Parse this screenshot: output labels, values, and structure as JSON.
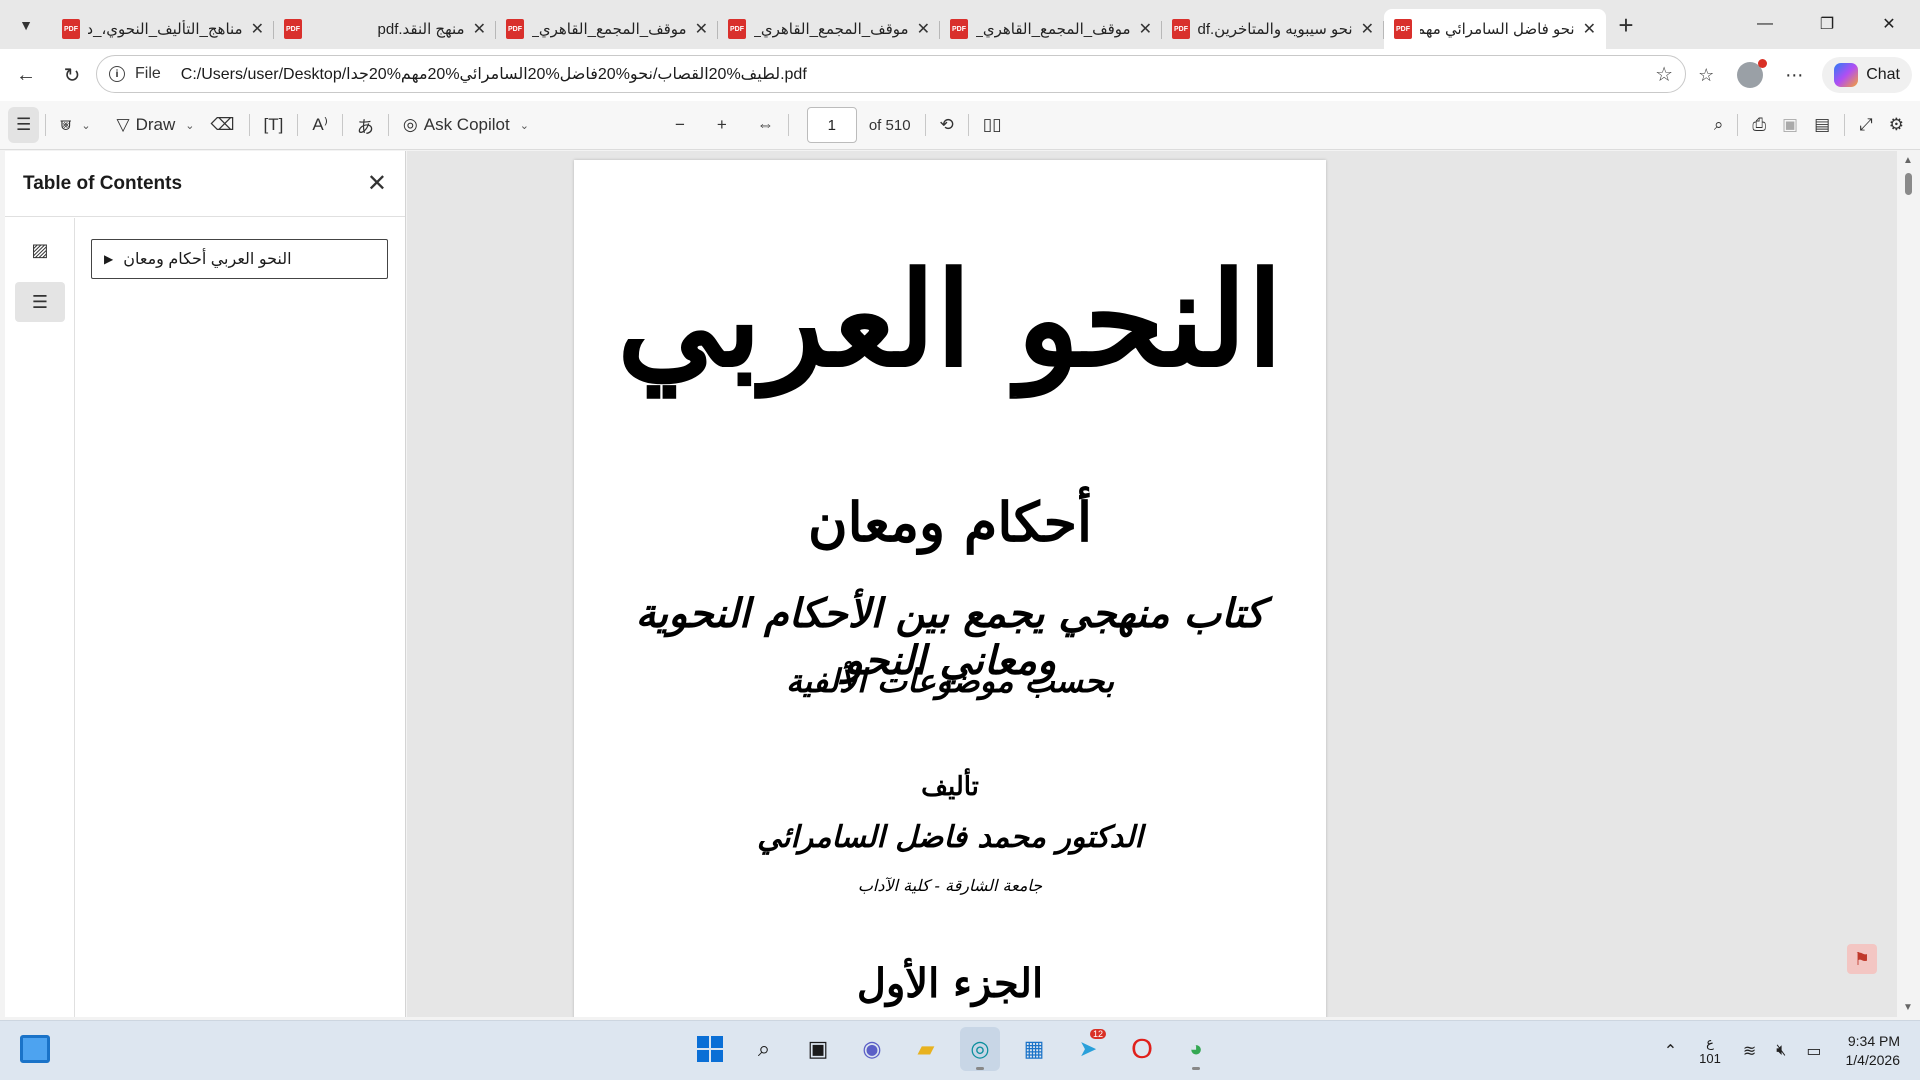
{
  "tabs": [
    {
      "label": "مناهج_التأليف_النحوي،_د...",
      "active": false
    },
    {
      "label": "منهج النقد.pdf",
      "active": false
    },
    {
      "label": "موقف_المجمع_القاهري_م...",
      "active": false
    },
    {
      "label": "موقف_المجمع_القاهري_م...",
      "active": false
    },
    {
      "label": "موقف_المجمع_القاهري_م...",
      "active": false
    },
    {
      "label": "نحو سيبويه والمتاخرين.pdf",
      "active": false
    },
    {
      "label": "نحو فاضل السامرائي مهم",
      "active": true
    }
  ],
  "pdf_icon_text": "PDF",
  "address": {
    "scheme": "File",
    "url": "C:/Users/user/Desktop/لطيف%20القصاب/نحو%20فاضل%20السامرائي%20مهم%20جدا.pdf"
  },
  "chat_label": "Chat",
  "toolbar": {
    "draw_label": "Draw",
    "ask_copilot_label": "Ask Copilot",
    "page_number": "1",
    "page_total": "of 510"
  },
  "sidepanel": {
    "title": "Table of Contents",
    "toc_items": [
      "النحو العربي أحكام ومعان"
    ]
  },
  "document": {
    "title": "النحو العربي",
    "subtitle": "أحكام ومعان",
    "description_line1": "كتاب منهجي يجمع بين الأحكام النحوية ومعاني النحو",
    "description_line2": "بحسب موضوعات الألفية",
    "by_label": "تأليف",
    "author": "الدكتور محمد فاضل السامرائي",
    "affiliation": "جامعة الشارقة - كلية الآداب",
    "part": "الجزء الأول"
  },
  "taskbar": {
    "telegram_badge": "12",
    "language_line1": "ع",
    "language_line2": "101",
    "time": "9:34 PM",
    "date": "1/4/2026"
  },
  "colors": {
    "accent": "#0a6fd6",
    "pdf_red": "#d9302c",
    "tabstrip_bg": "#e8e8e8",
    "viewer_bg": "#e6e6e6"
  }
}
